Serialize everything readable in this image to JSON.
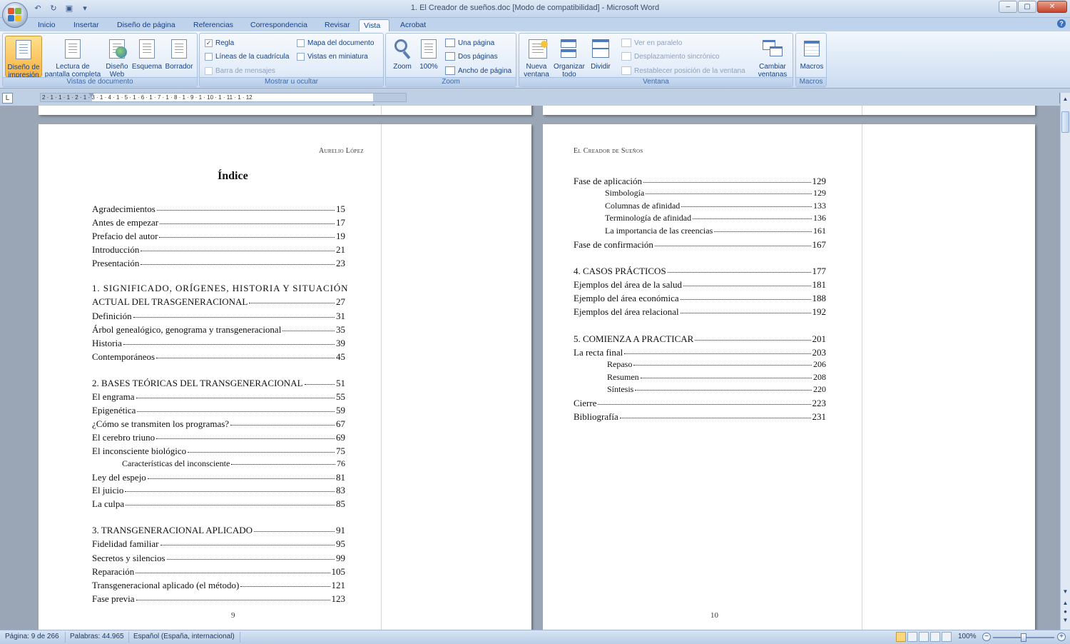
{
  "window": {
    "title": "1. El Creador de sueños.doc [Modo de compatibilidad] - Microsoft Word"
  },
  "tabs": [
    {
      "label": "Inicio",
      "active": false
    },
    {
      "label": "Insertar",
      "active": false
    },
    {
      "label": "Diseño de página",
      "active": false
    },
    {
      "label": "Referencias",
      "active": false
    },
    {
      "label": "Correspondencia",
      "active": false
    },
    {
      "label": "Revisar",
      "active": false
    },
    {
      "label": "Vista",
      "active": true
    },
    {
      "label": "Acrobat",
      "active": false
    }
  ],
  "ribbon": {
    "vistas": {
      "label": "Vistas de documento",
      "print_layout": "Diseño de impresión",
      "full_screen": "Lectura de pantalla completa",
      "web_layout": "Diseño Web",
      "outline": "Esquema",
      "draft": "Borrador"
    },
    "mostrar": {
      "label": "Mostrar u ocultar",
      "regla": "Regla",
      "lineas": "Líneas de la cuadrícula",
      "barra": "Barra de mensajes",
      "mapa": "Mapa del documento",
      "miniaturas": "Vistas en miniatura"
    },
    "zoom": {
      "label": "Zoom",
      "zoom": "Zoom",
      "hundred": "100%",
      "one_page": "Una página",
      "two_pages": "Dos páginas",
      "page_width": "Ancho de página"
    },
    "ventana": {
      "label": "Ventana",
      "new_window": "Nueva ventana",
      "arrange": "Organizar todo",
      "split": "Dividir",
      "side_by_side": "Ver en paralelo",
      "sync_scroll": "Desplazamiento sincrónico",
      "reset_pos": "Restablecer posición de la ventana",
      "switch": "Cambiar ventanas"
    },
    "macros": {
      "label": "Macros",
      "macros": "Macros"
    }
  },
  "ruler": {
    "numbers": "2 · 1 · 1 · 1 · 2 · 1 · 3 · 1 · 4 · 1 · 5 · 1 · 6 · 1 · 7 · 1 · 8 · 1 · 9 · 1 · 10 · 1 · 11 · 1 · 12"
  },
  "page_left": {
    "header": "Aurelio López",
    "title": "Índice",
    "page_number": "9",
    "entries": [
      {
        "label": "Agradecimientos",
        "page": "15"
      },
      {
        "label": "Antes de empezar",
        "page": "17"
      },
      {
        "label": "Prefacio del autor",
        "page": "19"
      },
      {
        "label": "Introducción",
        "page": "21"
      },
      {
        "label": "Presentación",
        "page": "23"
      },
      {
        "label": "1. SIGNIFICADO, ORÍGENES, HISTORIA Y SITUACIÓN",
        "page": ""
      },
      {
        "label": "ACTUAL DEL TRASGENERACIONAL",
        "page": "27"
      },
      {
        "label": "Definición",
        "page": "31"
      },
      {
        "label": "Árbol genealógico, genograma y transgeneracional",
        "page": "35"
      },
      {
        "label": "Historia",
        "page": "39"
      },
      {
        "label": "Contemporáneos",
        "page": "45"
      },
      {
        "label": "2. BASES TEÓRICAS DEL TRANSGENERACIONAL",
        "page": "51"
      },
      {
        "label": "El engrama",
        "page": "55"
      },
      {
        "label": "Epigenética",
        "page": "59"
      },
      {
        "label": "¿Cómo se transmiten los programas?",
        "page": "67"
      },
      {
        "label": "El cerebro triuno",
        "page": "69"
      },
      {
        "label": "El inconsciente biológico",
        "page": "75"
      },
      {
        "label": "Características del inconsciente",
        "page": "76"
      },
      {
        "label": "Ley del espejo",
        "page": "81"
      },
      {
        "label": "El juicio",
        "page": "83"
      },
      {
        "label": "La culpa",
        "page": "85"
      },
      {
        "label": "3. TRANSGENERACIONAL APLICADO",
        "page": "91"
      },
      {
        "label": "Fidelidad familiar",
        "page": "95"
      },
      {
        "label": "Secretos y silencios",
        "page": "99"
      },
      {
        "label": "Reparación",
        "page": "105"
      },
      {
        "label": "Transgeneracional aplicado (el método)",
        "page": "121"
      },
      {
        "label": "Fase previa",
        "page": "123"
      }
    ]
  },
  "page_right": {
    "header": "El Creador de Sueños",
    "page_number": "10",
    "entries": [
      {
        "label": "Fase de aplicación",
        "page": "129"
      },
      {
        "label": "Simbología",
        "page": "129"
      },
      {
        "label": "Columnas de afinidad",
        "page": "133"
      },
      {
        "label": "Terminología de afinidad",
        "page": "136"
      },
      {
        "label": "La importancia de las creencias",
        "page": "161"
      },
      {
        "label": "Fase de confirmación",
        "page": "167"
      },
      {
        "label": "4. CASOS PRÁCTICOS",
        "page": "177"
      },
      {
        "label": "Ejemplos del área de la salud",
        "page": "181"
      },
      {
        "label": "Ejemplo del área económica",
        "page": "188"
      },
      {
        "label": "Ejemplos del área relacional",
        "page": "192"
      },
      {
        "label": "5. COMIENZA A PRACTICAR",
        "page": "201"
      },
      {
        "label": "La recta final",
        "page": "203"
      },
      {
        "label": "Repaso",
        "page": "206"
      },
      {
        "label": "Resumen",
        "page": "208"
      },
      {
        "label": "Síntesis",
        "page": "220"
      },
      {
        "label": "Cierre",
        "page": "223"
      },
      {
        "label": "Bibliografía",
        "page": "231"
      }
    ]
  },
  "status": {
    "page": "Página: 9 de 266",
    "words": "Palabras: 44.965",
    "language": "Español (España, internacional)",
    "zoom": "100%"
  }
}
